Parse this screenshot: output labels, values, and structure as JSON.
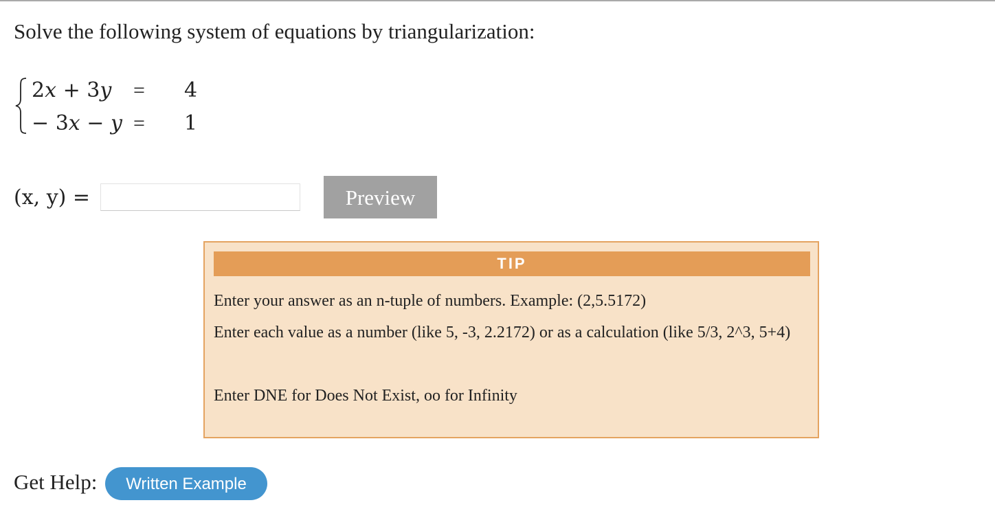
{
  "question": {
    "text": "Solve the following system of equations by triangularization:"
  },
  "system": {
    "equations": [
      {
        "lhs": "2x + 3y",
        "op": "=",
        "rhs": "4"
      },
      {
        "lhs": "− 3x − y",
        "op": "=",
        "rhs": "1"
      }
    ]
  },
  "answer": {
    "label": "(x, y) =",
    "value": "",
    "placeholder": ""
  },
  "preview_button": {
    "label": "Preview"
  },
  "tip": {
    "header": "TIP",
    "lines": [
      "Enter your answer as an n-tuple of numbers. Example: (2,5.5172)",
      "Enter each value as a number (like 5, -3, 2.2172) or as a calculation (like 5/3, 2^3, 5+4)",
      "Enter DNE for Does Not Exist, oo for Infinity"
    ]
  },
  "help": {
    "label": "Get Help:",
    "written_example_label": "Written Example"
  },
  "colors": {
    "top_rule": "#a9a9a9",
    "preview_button": "#a1a1a1",
    "tip_background": "#f8e2c8",
    "tip_border": "#e4a360",
    "tip_header": "#e49d57",
    "help_button": "#4395cf"
  }
}
